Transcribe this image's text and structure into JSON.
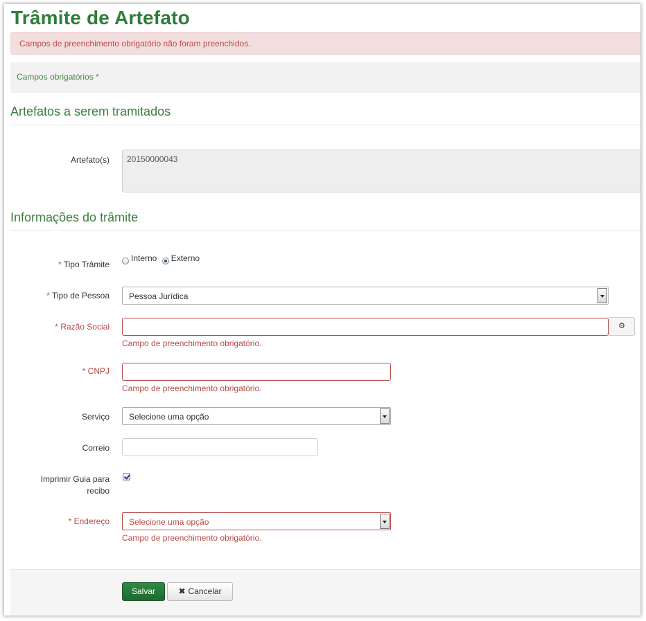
{
  "page": {
    "title": "Trâmite de Artefato"
  },
  "alert": {
    "message": "Campos de preenchimento obrigatório não foram preenchidos."
  },
  "required_note": "Campos obrigatórios *",
  "sections": {
    "artefatos": "Artefatos a serem tramitados",
    "informacoes": "Informações do trâmite"
  },
  "artefatos": {
    "label": "Artefato(s)",
    "value": "20150000043"
  },
  "tipo_tramite": {
    "label": "Tipo Trâmite",
    "options": [
      "Interno",
      "Externo"
    ],
    "selected": "Externo"
  },
  "tipo_pessoa": {
    "label": "Tipo de Pessoa",
    "value": "Pessoa Jurídica"
  },
  "razao_social": {
    "label": "Razão Social",
    "value": "",
    "error": "Campo de preenchimento obrigatório."
  },
  "cnpj": {
    "label": "CNPJ",
    "value": "",
    "error": "Campo de preenchimento obrigatório."
  },
  "servico": {
    "label": "Serviço",
    "value": "Selecione uma opção"
  },
  "correio": {
    "label": "Correio",
    "value": ""
  },
  "imprimir_guia": {
    "label": "Imprimir Guia para recibo",
    "checked": true
  },
  "endereco": {
    "label": "Endereço",
    "value": "Selecione uma opção",
    "error": "Campo de preenchimento obrigatório."
  },
  "actions": {
    "save": "Salvar",
    "cancel": "Cancelar"
  },
  "required_marker": "*",
  "icons": {
    "addon": "gear-icon",
    "cancel": "close-icon"
  }
}
